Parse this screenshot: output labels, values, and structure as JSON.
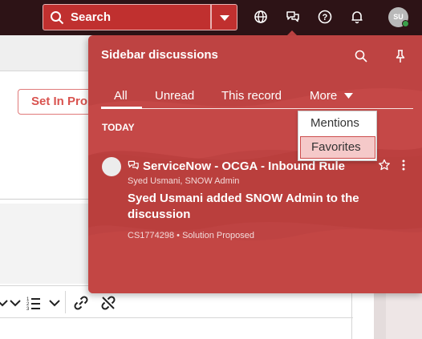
{
  "topbar": {
    "search_label": "Search",
    "icons": [
      "search-icon",
      "chevron-down-icon",
      "globe-icon",
      "chat-icon",
      "help-icon",
      "bell-icon"
    ],
    "avatar_initials": "SU",
    "presence_color": "#3aa04a"
  },
  "background": {
    "action_button_label": "Set In Proposed"
  },
  "sidebar": {
    "title": "Sidebar discussions",
    "tabs": [
      {
        "label": "All",
        "active": true
      },
      {
        "label": "Unread"
      },
      {
        "label": "This record"
      },
      {
        "label": "More"
      }
    ],
    "section_label": "TODAY",
    "discussion": {
      "title": "ServiceNow - OCGA - Inbound Rule",
      "participants": "Syed Usmani, SNOW Admin",
      "message": "Syed Usmani added SNOW Admin to the discussion",
      "meta": "CS1774298 • Solution Proposed"
    }
  },
  "more_menu": {
    "items": [
      {
        "label": "Mentions"
      },
      {
        "label": "Favorites",
        "selected": true
      }
    ]
  },
  "colors": {
    "topbar_bg": "#2d1316",
    "accent": "#be4342",
    "search_bg": "#c0302f",
    "selected_item_bg": "#f5c9c9"
  }
}
